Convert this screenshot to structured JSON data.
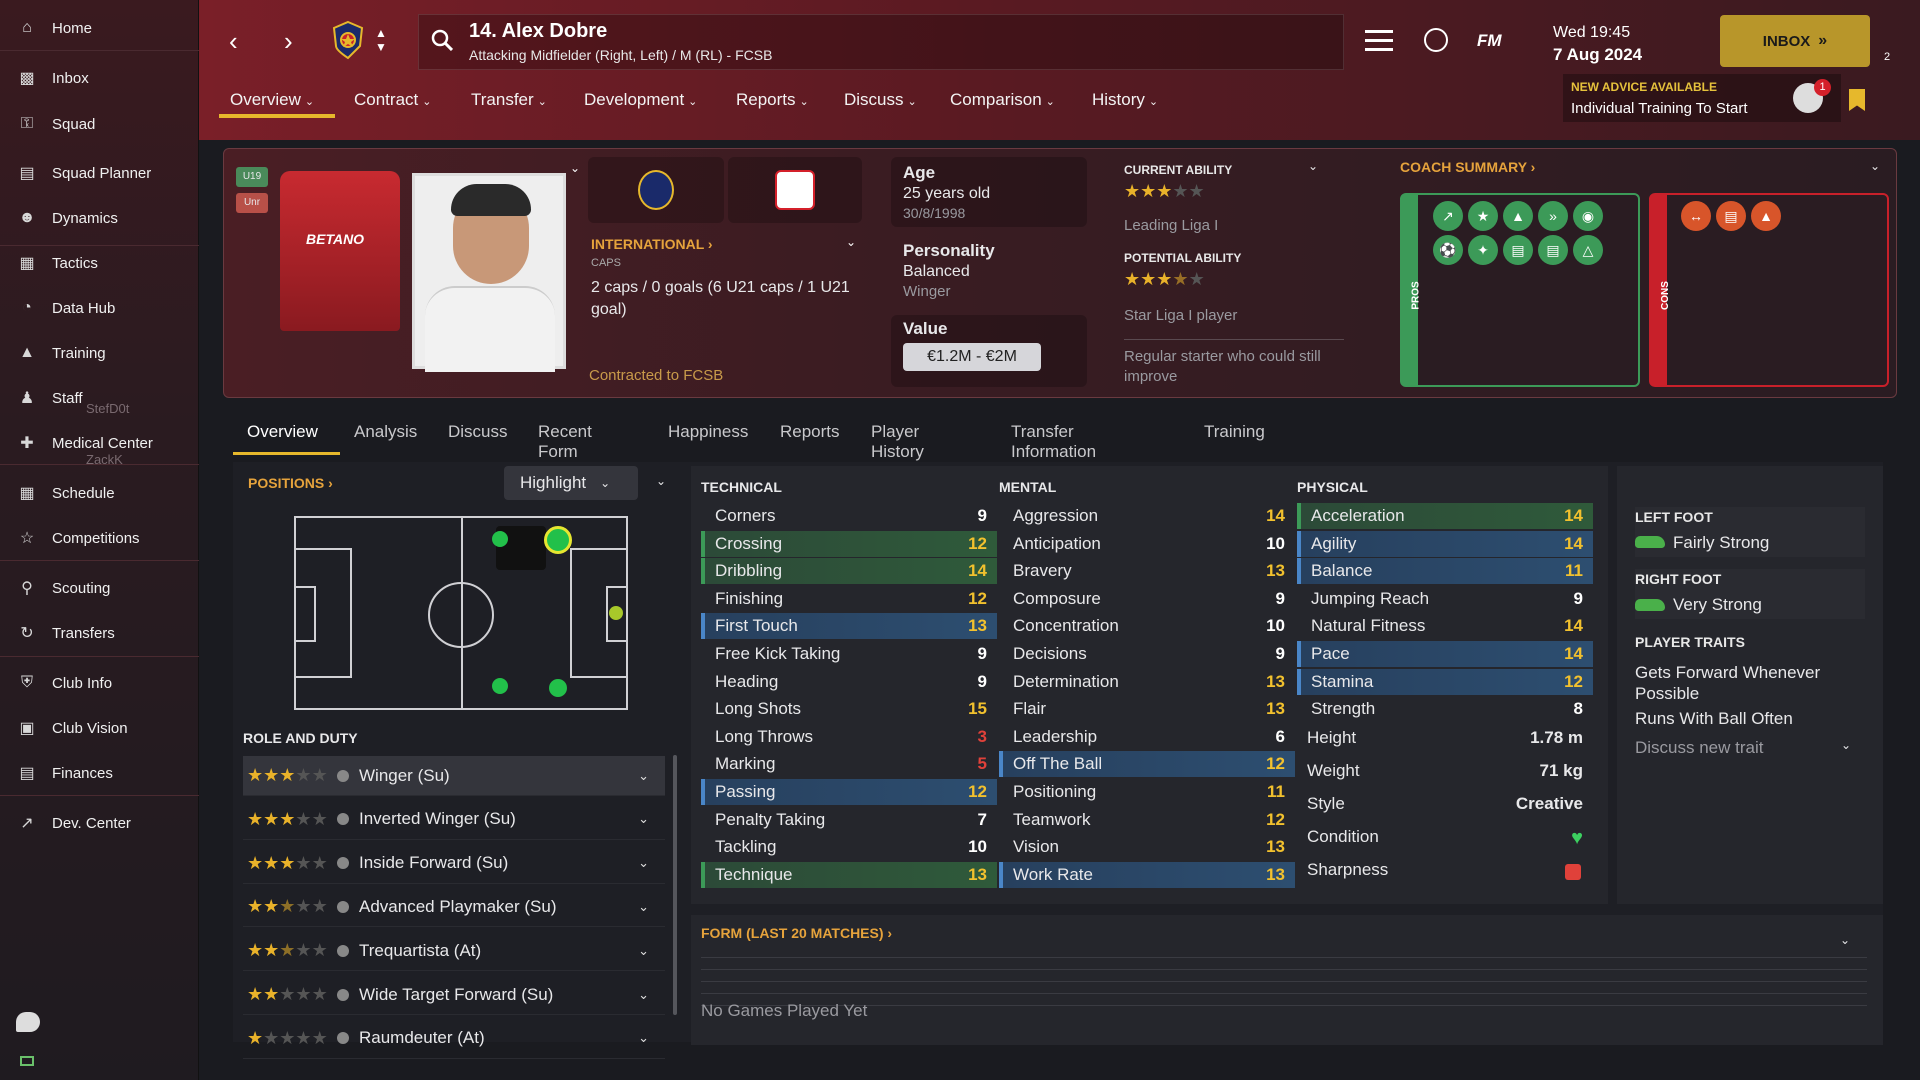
{
  "sidebar": {
    "items": [
      {
        "label": "Home",
        "icon": "home-icon"
      },
      {
        "label": "Inbox",
        "icon": "inbox-icon"
      },
      {
        "label": "Squad",
        "icon": "squad-icon"
      },
      {
        "label": "Squad Planner",
        "icon": "squad-planner-icon"
      },
      {
        "label": "Dynamics",
        "icon": "dynamics-icon"
      },
      {
        "label": "Tactics",
        "icon": "tactics-icon"
      },
      {
        "label": "Data Hub",
        "icon": "data-hub-icon"
      },
      {
        "label": "Training",
        "icon": "training-icon"
      },
      {
        "label": "Staff",
        "icon": "staff-icon"
      },
      {
        "label": "Medical Center",
        "icon": "medical-icon"
      },
      {
        "label": "Schedule",
        "icon": "schedule-icon"
      },
      {
        "label": "Competitions",
        "icon": "trophy-icon"
      },
      {
        "label": "Scouting",
        "icon": "scouting-icon"
      },
      {
        "label": "Transfers",
        "icon": "transfers-icon"
      },
      {
        "label": "Club Info",
        "icon": "club-info-icon"
      },
      {
        "label": "Club Vision",
        "icon": "club-vision-icon"
      },
      {
        "label": "Finances",
        "icon": "finances-icon"
      },
      {
        "label": "Dev. Center",
        "icon": "dev-center-icon"
      }
    ],
    "staff_sub": "StefD0t",
    "medical_sub": "ZackK"
  },
  "header": {
    "player_title": "14. Alex Dobre",
    "player_subtitle": "Attacking Midfielder (Right, Left) / M (RL) - FCSB",
    "fm_label": "FM",
    "day_time": "Wed 19:45",
    "date": "7 Aug 2024",
    "inbox_label": "INBOX",
    "inbox_count": "2",
    "advice_title": "NEW ADVICE AVAILABLE",
    "advice_text": "Individual Training To Start",
    "advice_badge": "1",
    "menu": [
      "Overview",
      "Contract",
      "Transfer",
      "Development",
      "Reports",
      "Discuss",
      "Comparison",
      "History"
    ]
  },
  "profile": {
    "badge_u19": "U19",
    "badge_unr": "Unr",
    "shirt_sponsor": "BETANO",
    "international_label": "INTERNATIONAL",
    "caps_label": "CAPS",
    "caps_text": "2 caps / 0 goals (6 U21 caps / 1 U21 goal)",
    "contract_text": "Contracted to FCSB",
    "age_label": "Age",
    "age_value": "25 years old",
    "dob": "30/8/1998",
    "personality_label": "Personality",
    "personality_value": "Balanced",
    "personality_sub": "Winger",
    "value_label": "Value",
    "value_amount": "€1.2M - €2M",
    "ca_label": "CURRENT ABILITY",
    "ca_stars": 3,
    "ca_text": "Leading Liga I",
    "pa_label": "POTENTIAL ABILITY",
    "pa_stars": 3.5,
    "pa_text": "Star Liga I player",
    "pa_note": "Regular starter who could still improve",
    "coach_label": "COACH SUMMARY",
    "pros_label": "PROS",
    "cons_label": "CONS"
  },
  "tabs": [
    "Overview",
    "Analysis",
    "Discuss",
    "Recent Form",
    "Happiness",
    "Reports",
    "Player History",
    "Transfer Information",
    "Training"
  ],
  "positions": {
    "label": "POSITIONS",
    "highlight_label": "Highlight"
  },
  "roles": {
    "label": "ROLE AND DUTY",
    "items": [
      {
        "name": "Winger (Su)",
        "stars": 3
      },
      {
        "name": "Inverted Winger (Su)",
        "stars": 3
      },
      {
        "name": "Inside Forward (Su)",
        "stars": 3
      },
      {
        "name": "Advanced Playmaker (Su)",
        "stars": 2.5
      },
      {
        "name": "Trequartista (At)",
        "stars": 2.5
      },
      {
        "name": "Wide Target Forward (Su)",
        "stars": 2
      },
      {
        "name": "Raumdeuter (At)",
        "stars": 1
      }
    ]
  },
  "technical": {
    "label": "TECHNICAL",
    "items": [
      {
        "name": "Corners",
        "value": "9",
        "hl": "",
        "color": "#ffffff"
      },
      {
        "name": "Crossing",
        "value": "12",
        "hl": "green",
        "color": "#f2c12e"
      },
      {
        "name": "Dribbling",
        "value": "14",
        "hl": "green",
        "color": "#f2c12e"
      },
      {
        "name": "Finishing",
        "value": "12",
        "hl": "",
        "color": "#f2c12e"
      },
      {
        "name": "First Touch",
        "value": "13",
        "hl": "blue",
        "color": "#f2c12e"
      },
      {
        "name": "Free Kick Taking",
        "value": "9",
        "hl": "",
        "color": "#ffffff"
      },
      {
        "name": "Heading",
        "value": "9",
        "hl": "",
        "color": "#ffffff"
      },
      {
        "name": "Long Shots",
        "value": "15",
        "hl": "",
        "color": "#f2c12e"
      },
      {
        "name": "Long Throws",
        "value": "3",
        "hl": "",
        "color": "#e0413a"
      },
      {
        "name": "Marking",
        "value": "5",
        "hl": "",
        "color": "#e0413a"
      },
      {
        "name": "Passing",
        "value": "12",
        "hl": "blue",
        "color": "#f2c12e"
      },
      {
        "name": "Penalty Taking",
        "value": "7",
        "hl": "",
        "color": "#ffffff"
      },
      {
        "name": "Tackling",
        "value": "10",
        "hl": "",
        "color": "#ffffff"
      },
      {
        "name": "Technique",
        "value": "13",
        "hl": "green",
        "color": "#f2c12e"
      }
    ]
  },
  "mental": {
    "label": "MENTAL",
    "items": [
      {
        "name": "Aggression",
        "value": "14",
        "hl": "",
        "color": "#f2c12e"
      },
      {
        "name": "Anticipation",
        "value": "10",
        "hl": "",
        "color": "#ffffff"
      },
      {
        "name": "Bravery",
        "value": "13",
        "hl": "",
        "color": "#f2c12e"
      },
      {
        "name": "Composure",
        "value": "9",
        "hl": "",
        "color": "#ffffff"
      },
      {
        "name": "Concentration",
        "value": "10",
        "hl": "",
        "color": "#ffffff"
      },
      {
        "name": "Decisions",
        "value": "9",
        "hl": "",
        "color": "#ffffff"
      },
      {
        "name": "Determination",
        "value": "13",
        "hl": "",
        "color": "#f2c12e"
      },
      {
        "name": "Flair",
        "value": "13",
        "hl": "",
        "color": "#f2c12e"
      },
      {
        "name": "Leadership",
        "value": "6",
        "hl": "",
        "color": "#ffffff"
      },
      {
        "name": "Off The Ball",
        "value": "12",
        "hl": "blue",
        "color": "#f2c12e"
      },
      {
        "name": "Positioning",
        "value": "11",
        "hl": "",
        "color": "#f2c12e"
      },
      {
        "name": "Teamwork",
        "value": "12",
        "hl": "",
        "color": "#f2c12e"
      },
      {
        "name": "Vision",
        "value": "13",
        "hl": "",
        "color": "#f2c12e"
      },
      {
        "name": "Work Rate",
        "value": "13",
        "hl": "blue",
        "color": "#f2c12e"
      }
    ]
  },
  "physical": {
    "label": "PHYSICAL",
    "items": [
      {
        "name": "Acceleration",
        "value": "14",
        "hl": "green",
        "color": "#f2c12e"
      },
      {
        "name": "Agility",
        "value": "14",
        "hl": "blue",
        "color": "#f2c12e"
      },
      {
        "name": "Balance",
        "value": "11",
        "hl": "blue",
        "color": "#f2c12e"
      },
      {
        "name": "Jumping Reach",
        "value": "9",
        "hl": "",
        "color": "#ffffff"
      },
      {
        "name": "Natural Fitness",
        "value": "14",
        "hl": "",
        "color": "#f2c12e"
      },
      {
        "name": "Pace",
        "value": "14",
        "hl": "blue",
        "color": "#f2c12e"
      },
      {
        "name": "Stamina",
        "value": "12",
        "hl": "blue",
        "color": "#f2c12e"
      },
      {
        "name": "Strength",
        "value": "8",
        "hl": "",
        "color": "#ffffff"
      }
    ],
    "height_label": "Height",
    "height_value": "1.78 m",
    "weight_label": "Weight",
    "weight_value": "71 kg",
    "style_label": "Style",
    "style_value": "Creative",
    "condition_label": "Condition",
    "sharpness_label": "Sharpness"
  },
  "feet": {
    "left_label": "LEFT FOOT",
    "left_value": "Fairly Strong",
    "right_label": "RIGHT FOOT",
    "right_value": "Very Strong",
    "traits_label": "PLAYER TRAITS",
    "traits": [
      "Gets Forward Whenever Possible",
      "Runs With Ball Often"
    ],
    "discuss_trait": "Discuss new trait"
  },
  "form": {
    "label": "FORM (LAST 20 MATCHES)",
    "empty": "No Games Played Yet"
  },
  "colors": {
    "accent": "#e6a33c",
    "green": "#3c9a58",
    "blue": "#4a86c8",
    "inbox": "#b8962a"
  }
}
